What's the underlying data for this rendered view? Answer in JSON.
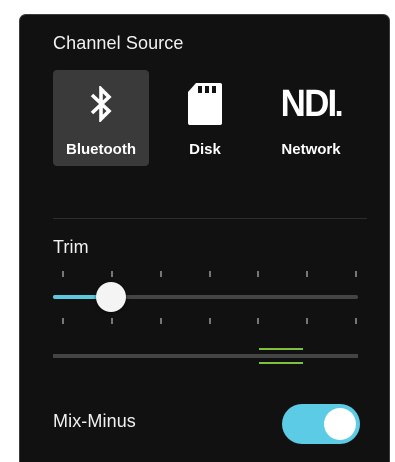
{
  "channel_source": {
    "title": "Channel Source",
    "options": [
      {
        "label": "Bluetooth",
        "icon": "bluetooth-icon",
        "selected": true
      },
      {
        "label": "Disk",
        "icon": "sd-card-icon",
        "selected": false
      },
      {
        "label": "Network",
        "icon": "ndi-logo",
        "logo_text": "NDI",
        "selected": false
      }
    ]
  },
  "trim": {
    "title": "Trim",
    "slider_fraction": 0.19,
    "tick_count": 7
  },
  "mix_minus": {
    "label": "Mix-Minus",
    "enabled": true
  },
  "colors": {
    "panel_background": "#111111",
    "selected_button": "#3a3a3a",
    "accent": "#5bc8e0",
    "meter_marker": "#7fc13c",
    "track": "#444444"
  }
}
